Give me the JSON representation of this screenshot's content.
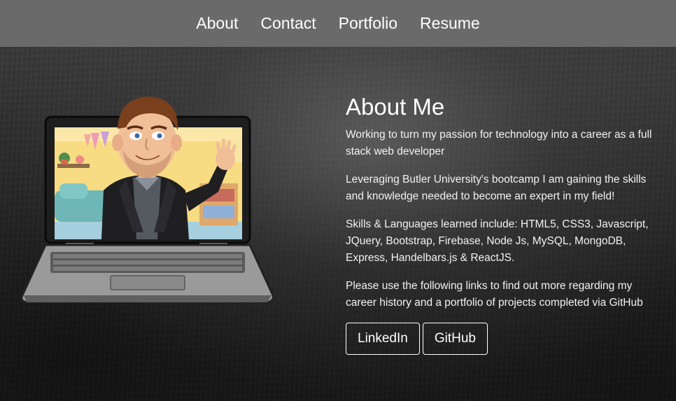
{
  "nav": {
    "items": [
      {
        "label": "About"
      },
      {
        "label": "Contact"
      },
      {
        "label": "Portfolio"
      },
      {
        "label": "Resume"
      }
    ]
  },
  "about": {
    "title": "About Me",
    "paragraphs": [
      "Working to turn my passion for technology into a career as a full stack web developer",
      "Leveraging Butler University's bootcamp I am gaining the skills and knowledge needed to become an expert in my field!",
      "Skills & Languages learned include: HTML5, CSS3, Javascript, JQuery, Bootstrap, Firebase, Node Js, MySQL, MongoDB, Express, Handelbars.js & ReactJS.",
      "Please use the following links to find out more regarding my career history and a portfolio of projects completed via GitHub"
    ],
    "buttons": {
      "linkedin": "LinkedIn",
      "github": "GitHub"
    }
  },
  "illustration": {
    "name": "bitmoji-laptop-avatar"
  },
  "colors": {
    "nav_bg": "#6a6a6a",
    "text": "#ffffff",
    "background": "#333333"
  }
}
